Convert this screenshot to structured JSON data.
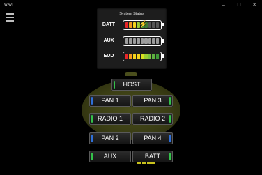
{
  "window": {
    "title": "WAVI",
    "controls": [
      "–",
      "□",
      "✕"
    ]
  },
  "system_status": {
    "title": "System Status",
    "rows": [
      {
        "label": "BATT",
        "charging": true,
        "cells": [
          "#e8262a",
          "#f39a1e",
          "#f4d31b",
          "#9acd32",
          "#5fb340",
          "#3e7a36",
          "#555555",
          "#555555",
          "#555555"
        ]
      },
      {
        "label": "AUX",
        "charging": false,
        "cells": [
          "#9c9c9c",
          "#9c9c9c",
          "#9c9c9c",
          "#9c9c9c",
          "#9c9c9c",
          "#9c9c9c",
          "#9c9c9c",
          "#9c9c9c",
          "#9c9c9c"
        ]
      },
      {
        "label": "EUD",
        "charging": false,
        "cells": [
          "#e8262a",
          "#f39a1e",
          "#f4d31b",
          "#f4d31b",
          "#d9e021",
          "#9acd32",
          "#7ac142",
          "#5fb340",
          "#3e9a36"
        ]
      }
    ]
  },
  "buttons": {
    "host": "HOST",
    "pan1": "PAN 1",
    "pan3": "PAN 3",
    "radio1": "RADIO 1",
    "radio2": "RADIO 2",
    "pan2": "PAN 2",
    "pan4": "PAN 4",
    "aux": "AUX",
    "batt": "BATT"
  },
  "colors": {
    "indicator_green": "#34c24a",
    "indicator_blue": "#2f6fd8",
    "arena": "#3a3d14",
    "mini_batt": "#c9c21d"
  }
}
